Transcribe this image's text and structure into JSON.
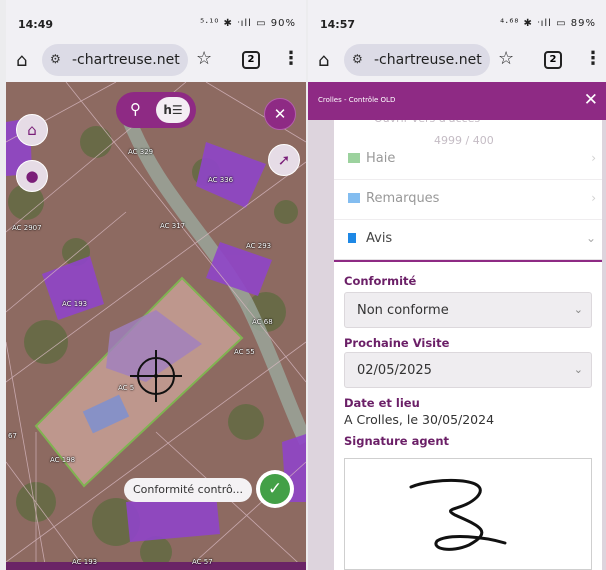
{
  "left_phone": {
    "status": {
      "time": "14:49",
      "system": "⁵·¹⁰ ✱ ᐧıll ▭ 90%"
    },
    "browser": {
      "url": "-chartreuse.net",
      "tab_count": "2"
    },
    "map": {
      "parcel_labels": [
        "AC 329",
        "AC 336",
        "AC 317",
        "AC 2907",
        "AC 293",
        "AC 193",
        "AC 68",
        "AC 55",
        "AC 5",
        "AC 198",
        "67",
        "AC 57",
        "AC 193"
      ],
      "layer_toggle_label": "h",
      "status_chip": "Conformité contrô...",
      "controls": {
        "home": "home-icon",
        "user": "user-pin-icon",
        "location": "location-pin-icon",
        "legend": "legend-icon",
        "measure": "crossed-tools-icon",
        "cursor": "cursor-select-icon",
        "validate": "check-icon"
      }
    }
  },
  "right_phone": {
    "status": {
      "time": "14:57",
      "system": "⁴·⁶⁸ ✱ ᐧıll ▭ 89%"
    },
    "browser": {
      "url": "-chartreuse.net",
      "tab_count": "2"
    },
    "header": {
      "title": "Crolles - Contrôle OLD"
    },
    "ghost_text": {
      "top": "Ouvrir vers d'accès",
      "second": "4999 / 400"
    },
    "accordion": [
      {
        "label": "Haie",
        "color": "#4caf50"
      },
      {
        "label": "Remarques",
        "color": "#1e88e5"
      },
      {
        "label": "Avis",
        "color": "#1e88e5"
      }
    ],
    "form": {
      "conformite": {
        "label": "Conformité",
        "value": "Non conforme"
      },
      "prochaine_visite": {
        "label": "Prochaine Visite",
        "value": "02/05/2025"
      },
      "date_lieu": {
        "label": "Date et lieu",
        "value": "A Crolles, le 30/05/2024"
      },
      "signature": {
        "label": "Signature agent"
      }
    }
  }
}
